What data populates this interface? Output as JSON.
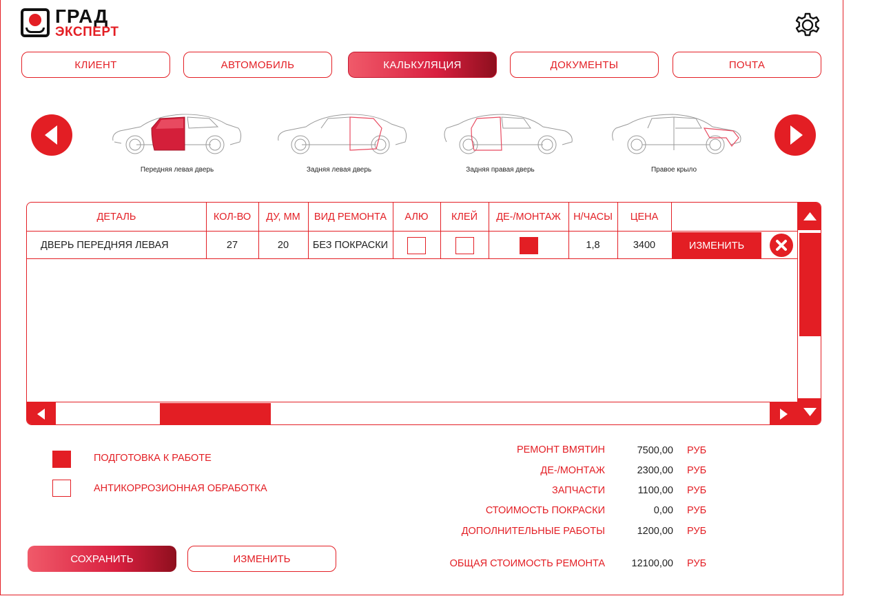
{
  "brand": {
    "line1": "ГРАД",
    "line2": "ЭКСПЕРТ",
    "accent": "#e31e24"
  },
  "header": {
    "settings_icon": "gear-icon"
  },
  "tabs": [
    {
      "label": "КЛИЕНТ",
      "active": false
    },
    {
      "label": "АВТОМОБИЛЬ",
      "active": false
    },
    {
      "label": "КАЛЬКУЛЯЦИЯ",
      "active": true
    },
    {
      "label": "ДОКУМЕНТЫ",
      "active": false
    },
    {
      "label": "ПОЧТА",
      "active": false
    }
  ],
  "carousel": {
    "prev_icon": "arrow-left-icon",
    "next_icon": "arrow-right-icon",
    "items": [
      {
        "caption": "Передняя левая дверь",
        "selected": true
      },
      {
        "caption": "Задняя левая дверь",
        "selected": false
      },
      {
        "caption": "Задняя правая дверь",
        "selected": false
      },
      {
        "caption": "Правое крыло",
        "selected": false
      }
    ]
  },
  "table": {
    "headers": [
      "ДЕТАЛЬ",
      "КОЛ-ВО",
      "ДУ, ММ",
      "ВИД РЕМОНТА",
      "АЛЮ",
      "КЛЕЙ",
      "ДЕ-/МОНТАЖ",
      "Н/ЧАСЫ",
      "ЦЕНА"
    ],
    "rows": [
      {
        "part": "ДВЕРЬ ПЕРЕДНЯЯ ЛЕВАЯ",
        "qty": "27",
        "du_mm": "20",
        "repair_type": "БЕЗ ПОКРАСКИ",
        "alu": false,
        "glue": false,
        "mount": true,
        "hours": "1,8",
        "price": "3400",
        "edit_label": "ИЗМЕНИТЬ"
      }
    ]
  },
  "options": [
    {
      "label": "ПОДГОТОВКА К РАБОТЕ",
      "checked": true
    },
    {
      "label": "АНТИКОРРОЗИОННАЯ ОБРАБОТКА",
      "checked": false
    }
  ],
  "summary": {
    "currency": "РУБ",
    "lines": [
      {
        "label": "РЕМОНТ ВМЯТИН",
        "value": "7500,00"
      },
      {
        "label": "ДЕ-/МОНТАЖ",
        "value": "2300,00"
      },
      {
        "label": "ЗАПЧАСТИ",
        "value": "1100,00"
      },
      {
        "label": "СТОИМОСТЬ ПОКРАСКИ",
        "value": "0,00"
      },
      {
        "label": "ДОПОЛНИТЕЛЬНЫЕ РАБОТЫ",
        "value": "1200,00"
      }
    ],
    "total": {
      "label": "ОБЩАЯ СТОИМОСТЬ РЕМОНТА",
      "value": "12100,00"
    }
  },
  "actions": {
    "save_label": "СОХРАНИТЬ",
    "edit_label": "ИЗМЕНИТЬ"
  }
}
